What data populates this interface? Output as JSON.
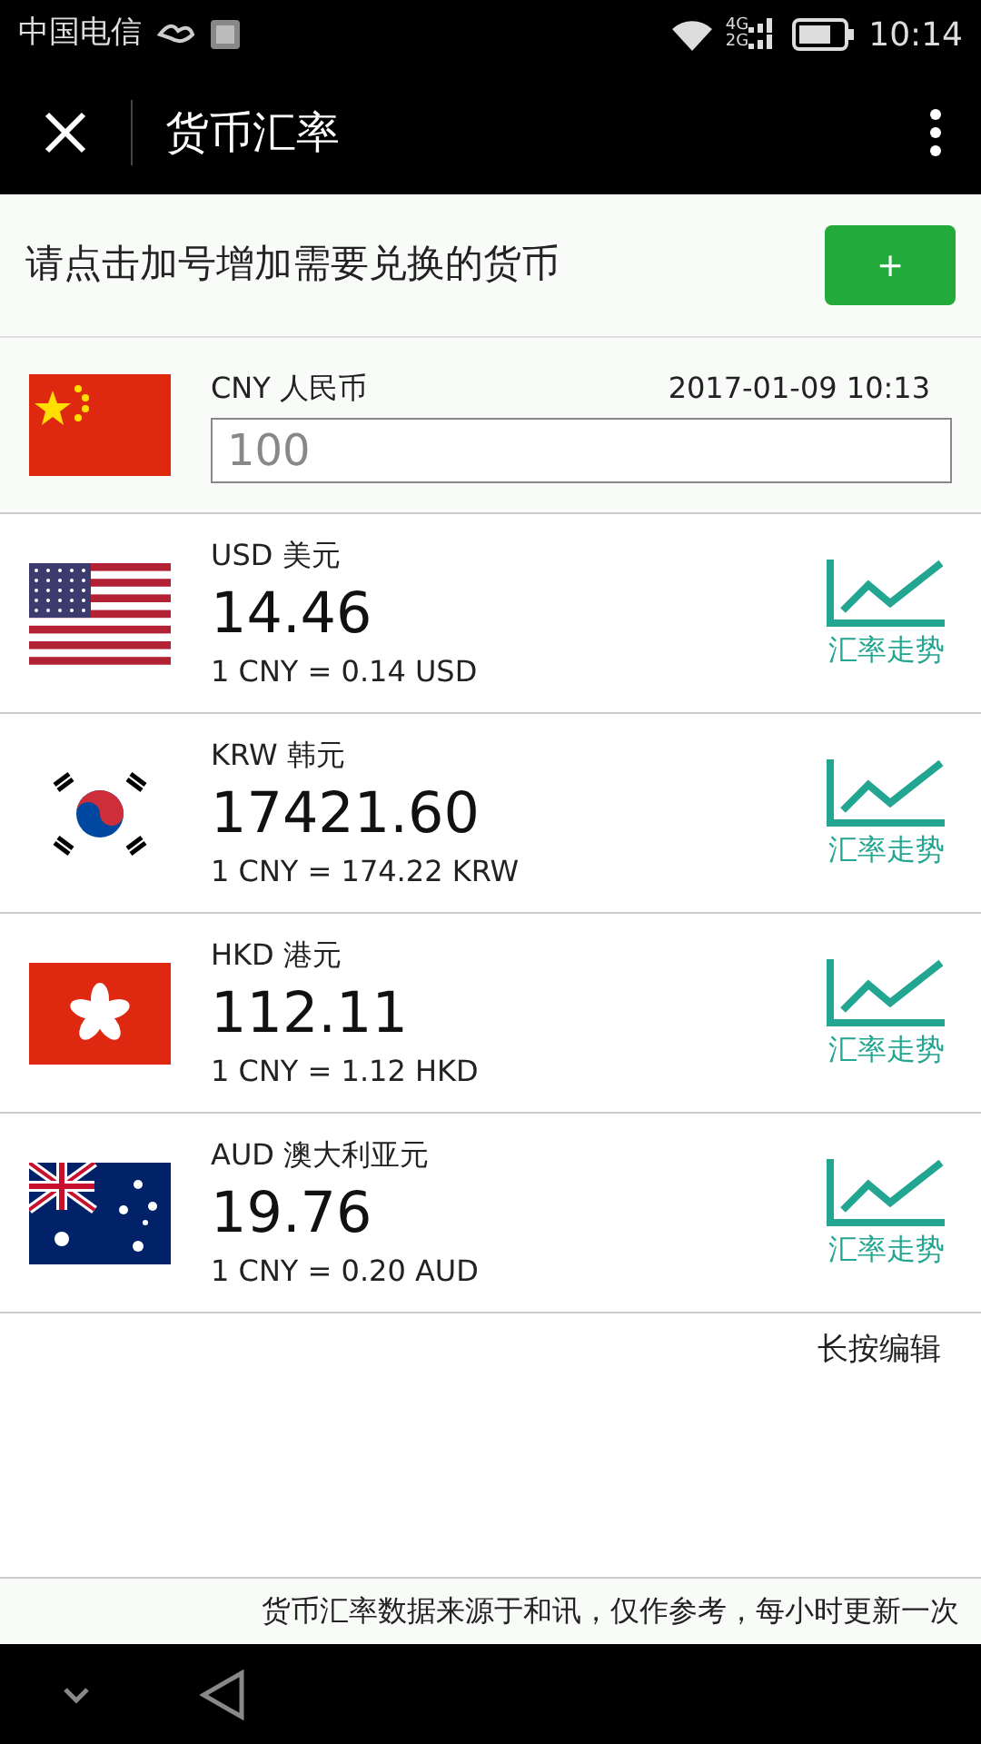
{
  "status_bar": {
    "carrier": "中国电信",
    "network_top": "4G",
    "network_bottom": "2G",
    "time": "10:14"
  },
  "header": {
    "title": "货币汇率"
  },
  "prompt": {
    "text": "请点击加号增加需要兑换的货币",
    "add_button": "+"
  },
  "base": {
    "kind": "cn",
    "label": "CNY 人民币",
    "updated": "2017-01-09 10:13",
    "amount": "100"
  },
  "currencies": [
    {
      "kind": "us",
      "label": "USD 美元",
      "value": "14.46",
      "rate": "1 CNY = 0.14 USD",
      "trend_label": "汇率走势"
    },
    {
      "kind": "kr",
      "label": "KRW 韩元",
      "value": "17421.60",
      "rate": "1 CNY = 174.22 KRW",
      "trend_label": "汇率走势"
    },
    {
      "kind": "hk",
      "label": "HKD 港元",
      "value": "112.11",
      "rate": "1 CNY = 1.12 HKD",
      "trend_label": "汇率走势"
    },
    {
      "kind": "au",
      "label": "AUD 澳大利亚元",
      "value": "19.76",
      "rate": "1 CNY = 0.20 AUD",
      "trend_label": "汇率走势"
    }
  ],
  "edit_hint": "长按编辑",
  "footer": "货币汇率数据来源于和讯，仅作参考，每小时更新一次"
}
